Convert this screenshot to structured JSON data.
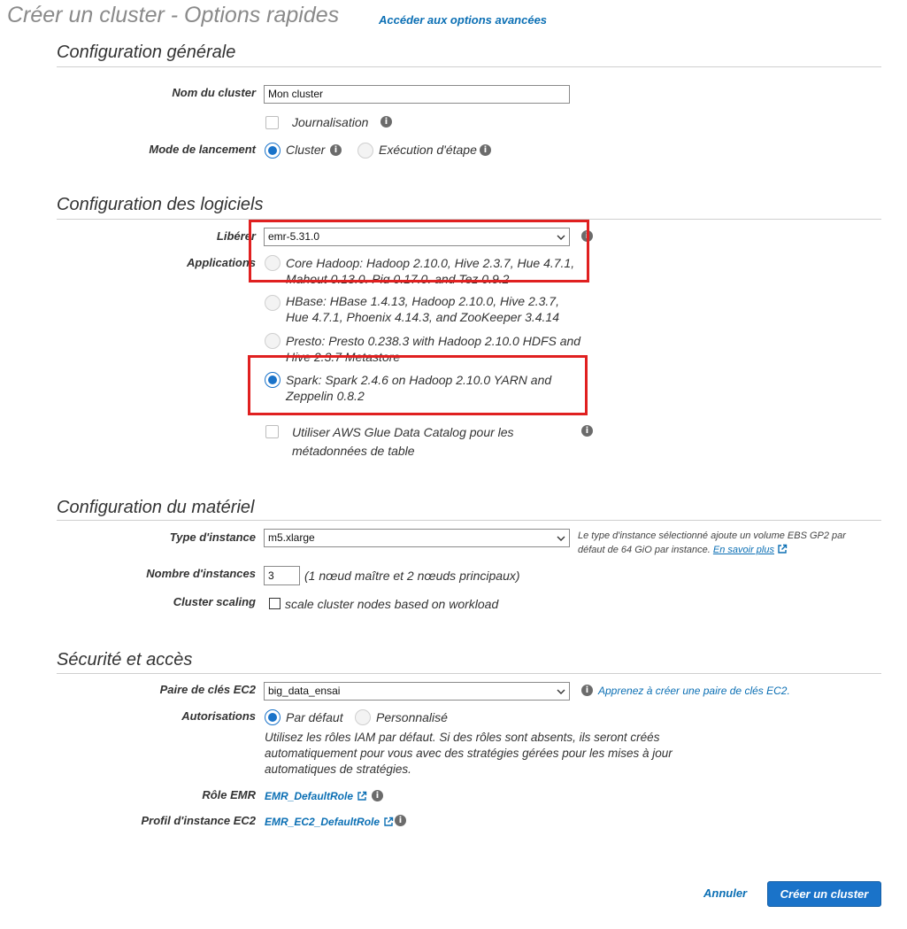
{
  "header": {
    "title": "Créer un cluster - Options rapides",
    "advanced_link": "Accéder aux options avancées"
  },
  "general": {
    "section_title": "Configuration générale",
    "cluster_name_label": "Nom du cluster",
    "cluster_name_value": "Mon cluster",
    "logging_label": "Journalisation",
    "launch_mode_label": "Mode de lancement",
    "launch_mode_options": [
      "Cluster",
      "Exécution d'étape"
    ],
    "launch_mode_selected": "Cluster"
  },
  "software": {
    "section_title": "Configuration des logiciels",
    "release_label": "Libérer",
    "release_value": "emr-5.31.0",
    "applications_label": "Applications",
    "applications": [
      "Core Hadoop: Hadoop 2.10.0, Hive 2.3.7, Hue 4.7.1, Mahout 0.13.0, Pig 0.17.0, and Tez 0.9.2",
      "HBase: HBase 1.4.13, Hadoop 2.10.0, Hive 2.3.7, Hue 4.7.1, Phoenix 4.14.3, and ZooKeeper 3.4.14",
      "Presto: Presto 0.238.3 with Hadoop 2.10.0 HDFS and Hive 2.3.7 Metastore",
      "Spark: Spark 2.4.6 on Hadoop 2.10.0 YARN and Zeppelin 0.8.2"
    ],
    "applications_selected": "Spark",
    "glue_label": "Utiliser AWS Glue Data Catalog pour les métadonnées de table"
  },
  "hardware": {
    "section_title": "Configuration du matériel",
    "instance_type_label": "Type d'instance",
    "instance_type_value": "m5.xlarge",
    "instance_note": "Le type d'instance sélectionné ajoute un volume EBS GP2 par défaut de 64 GiO par instance.",
    "learn_more": "En savoir plus",
    "instance_count_label": "Nombre d'instances",
    "instance_count_value": "3",
    "instance_count_note": "(1 nœud maître et 2 nœuds principaux)",
    "scaling_label": "Cluster scaling",
    "scaling_option": "scale cluster nodes based on workload"
  },
  "security": {
    "section_title": "Sécurité et accès",
    "keypair_label": "Paire de clés EC2",
    "keypair_value": "big_data_ensai",
    "keypair_help": "Apprenez à créer une paire de clés EC2.",
    "permissions_label": "Autorisations",
    "permission_options": [
      "Par défaut",
      "Personnalisé"
    ],
    "permission_selected": "Par défaut",
    "permission_note": "Utilisez les rôles IAM par défaut. Si des rôles sont absents, ils seront créés automatiquement pour vous avec des stratégies gérées pour les mises à jour automatiques de stratégies.",
    "emr_role_label": "Rôle EMR",
    "emr_role_value": "EMR_DefaultRole",
    "instance_profile_label": "Profil d'instance EC2",
    "instance_profile_value": "EMR_EC2_DefaultRole"
  },
  "footer": {
    "cancel": "Annuler",
    "create": "Créer un cluster"
  },
  "colors": {
    "accent": "#1a73c9",
    "link": "#0b6fb4",
    "highlight": "#e02020"
  },
  "icons": [
    "info-icon",
    "chevron-down-icon",
    "external-link-icon"
  ]
}
